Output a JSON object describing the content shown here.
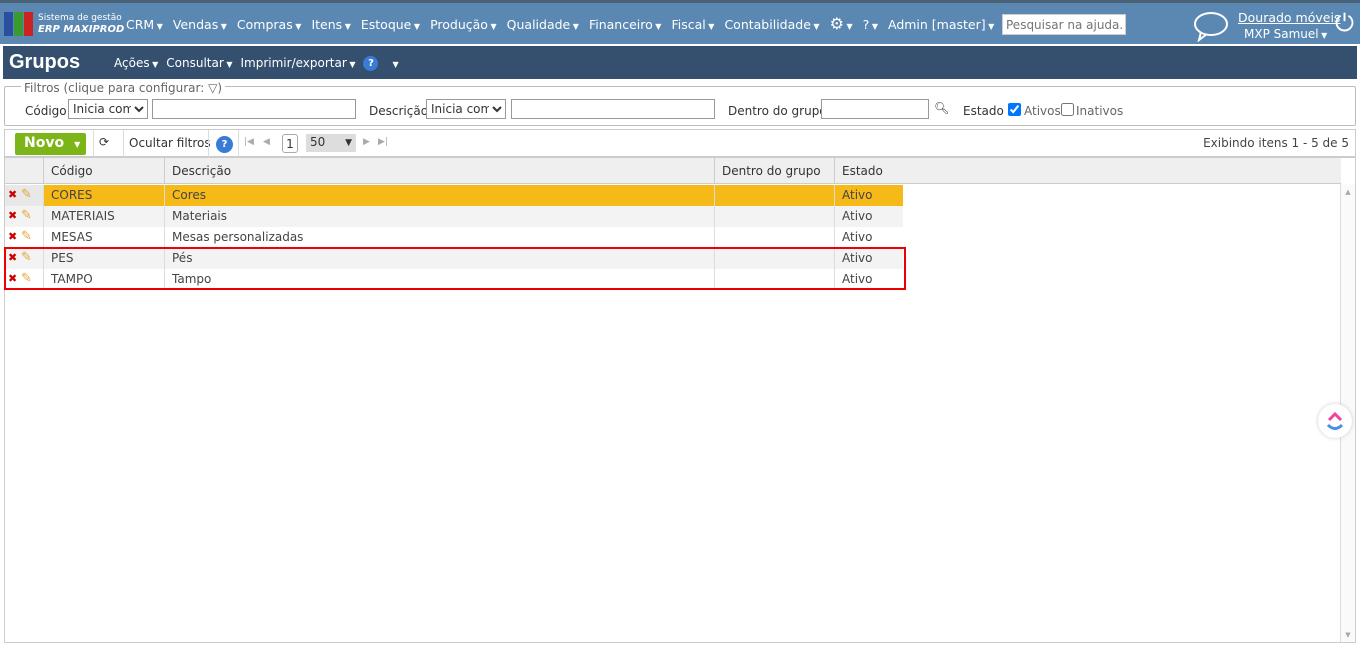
{
  "topbar": {
    "logo_line1": "Sistema de gestão",
    "logo_line2": "ERP MAXIPROD",
    "menu": [
      "CRM",
      "Vendas",
      "Compras",
      "Itens",
      "Estoque",
      "Produção",
      "Qualidade",
      "Financeiro",
      "Fiscal",
      "Contabilidade"
    ],
    "admin": "Admin [master]",
    "search_placeholder": "Pesquisar na ajuda...",
    "company": "Dourado móveis",
    "user": "MXP Samuel"
  },
  "titlebar": {
    "title": "Grupos",
    "menu": [
      "Ações",
      "Consultar",
      "Imprimir/exportar"
    ],
    "help": "?"
  },
  "filters": {
    "legend": "Filtros (clique para configurar:",
    "legend_end": ")",
    "codigo_label": "Código",
    "codigo_op": "Inicia com",
    "descricao_label": "Descrição",
    "descricao_op": "Inicia com",
    "dentro_label": "Dentro do grupo",
    "estado_label": "Estado",
    "ativos_label": "Ativos",
    "ativos_checked": true,
    "inativos_label": "Inativos",
    "inativos_checked": false
  },
  "toolbar": {
    "novo": "Novo",
    "ocultar": "Ocultar filtros",
    "page": "1",
    "page_size": "50",
    "status": "Exibindo itens 1 - 5 de 5"
  },
  "grid": {
    "columns": [
      "Código",
      "Descrição",
      "Dentro do grupo",
      "Estado"
    ],
    "rows": [
      {
        "codigo": "CORES",
        "descricao": "Cores",
        "dentro": "",
        "estado": "Ativo"
      },
      {
        "codigo": "MATERIAIS",
        "descricao": "Materiais",
        "dentro": "",
        "estado": "Ativo"
      },
      {
        "codigo": "MESAS",
        "descricao": "Mesas personalizadas",
        "dentro": "",
        "estado": "Ativo"
      },
      {
        "codigo": "PES",
        "descricao": "Pés",
        "dentro": "",
        "estado": "Ativo"
      },
      {
        "codigo": "TAMPO",
        "descricao": "Tampo",
        "dentro": "",
        "estado": "Ativo"
      }
    ]
  },
  "colors": {
    "topbar": "#5b88b3",
    "titlebar": "#34506e",
    "selected_row": "#f5b918",
    "novo": "#7cb518",
    "highlight": "#ee0000"
  }
}
